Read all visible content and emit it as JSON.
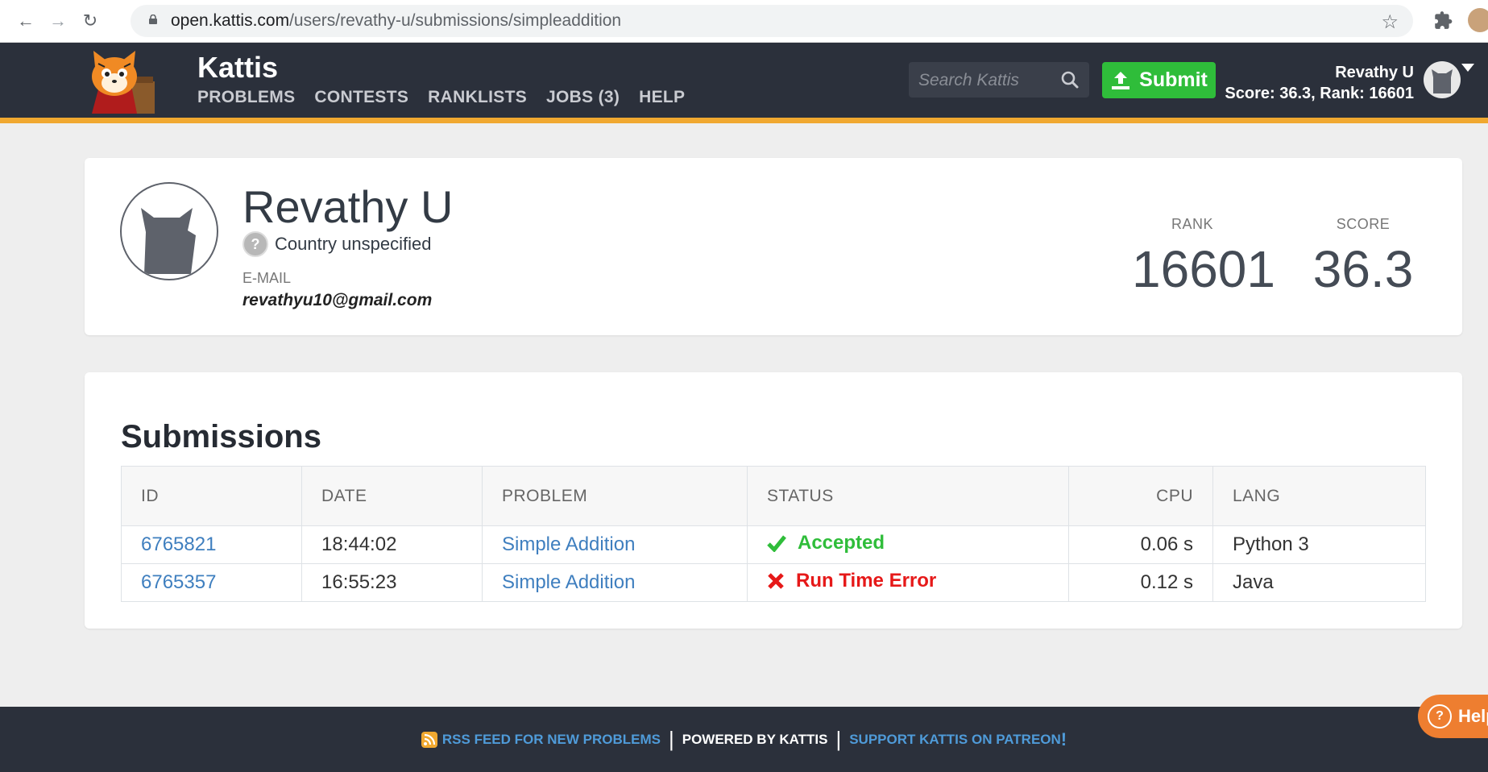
{
  "browser": {
    "url_host": "open.kattis.com",
    "url_path": "/users/revathy-u/submissions/simpleaddition"
  },
  "header": {
    "brand": "Kattis",
    "menu": [
      "PROBLEMS",
      "CONTESTS",
      "RANKLISTS",
      "JOBS (3)",
      "HELP"
    ],
    "search_placeholder": "Search Kattis",
    "submit_label": "Submit",
    "user_name": "Revathy U",
    "user_score_rank": "Score: 36.3, Rank: 16601"
  },
  "profile": {
    "name": "Revathy U",
    "country": "Country unspecified",
    "email_label": "E-MAIL",
    "email": "revathyu10@gmail.com",
    "rank_label": "RANK",
    "rank": "16601",
    "score_label": "SCORE",
    "score": "36.3"
  },
  "submissions": {
    "title": "Submissions",
    "columns": [
      "ID",
      "DATE",
      "PROBLEM",
      "STATUS",
      "CPU",
      "LANG"
    ],
    "rows": [
      {
        "id": "6765821",
        "date": "18:44:02",
        "problem": "Simple Addition",
        "status": "Accepted",
        "cpu": "0.06 s",
        "lang": "Python 3"
      },
      {
        "id": "6765357",
        "date": "16:55:23",
        "problem": "Simple Addition",
        "status": "Run Time Error",
        "cpu": "0.12 s",
        "lang": "Java"
      }
    ]
  },
  "footer": {
    "rss": "RSS FEED FOR NEW PROBLEMS",
    "powered": "POWERED BY KATTIS",
    "patreon": "SUPPORT KATTIS ON PATREON",
    "patreon_mark": "!"
  },
  "help_tab": "Help",
  "colors": {
    "header_bg": "#2b303b",
    "accent": "#f0a830",
    "submit_green": "#2fbd3a",
    "error_red": "#e61919",
    "link_blue": "#3f7fbf"
  }
}
